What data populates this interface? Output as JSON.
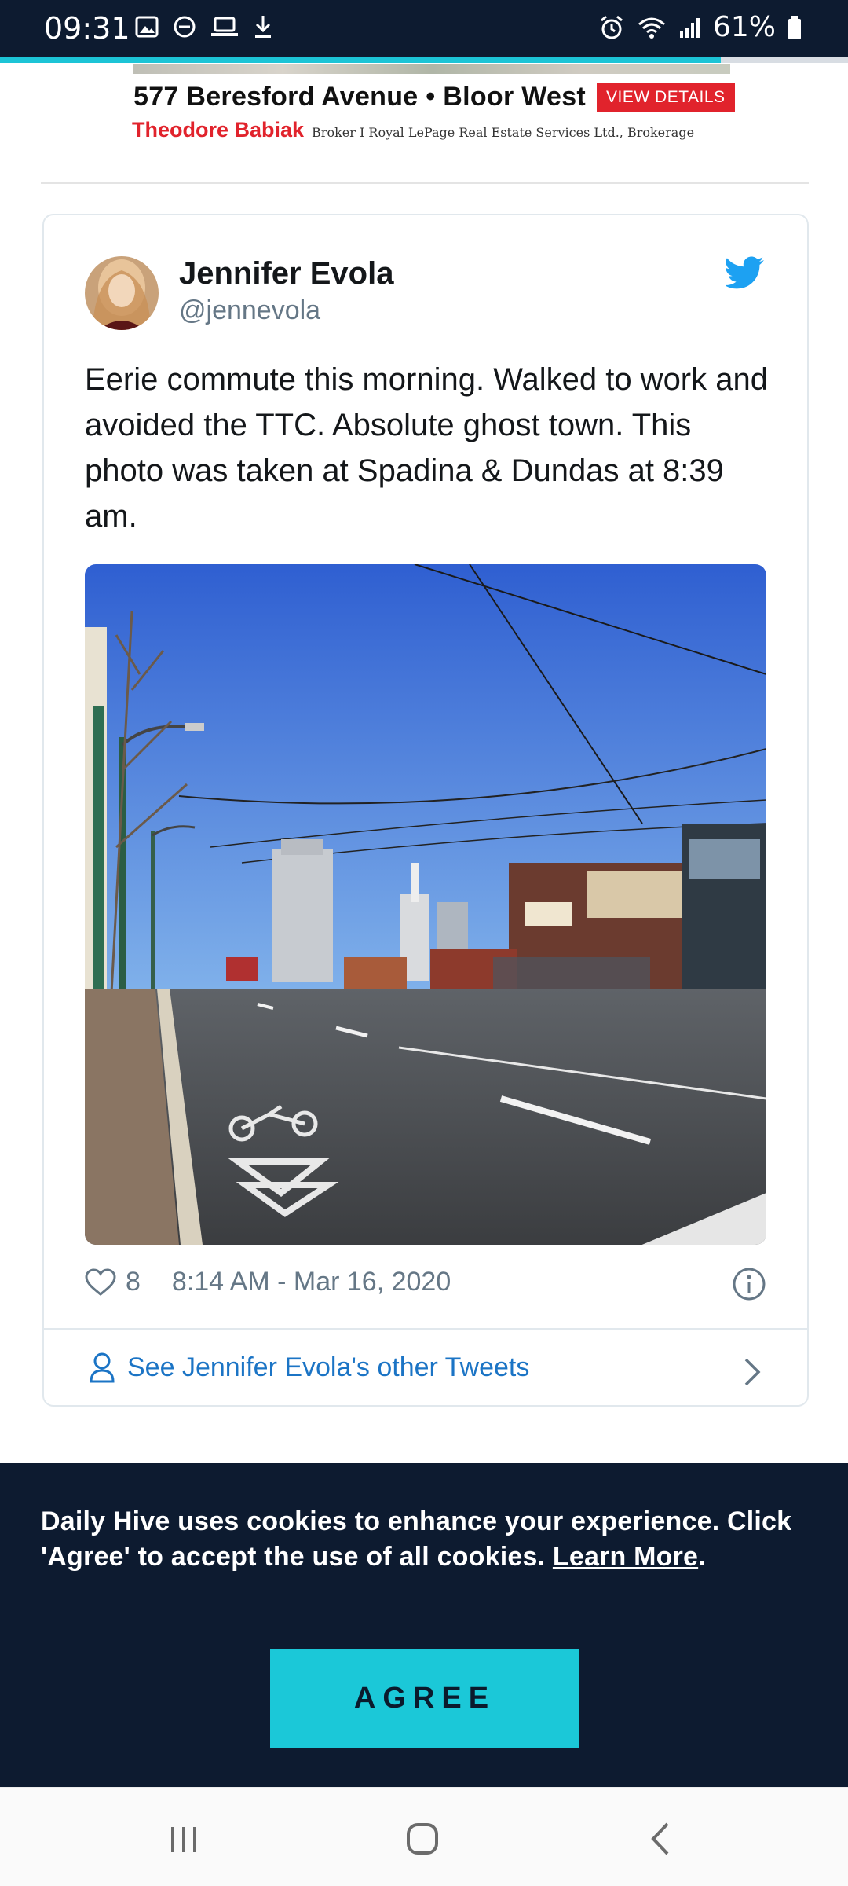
{
  "status_bar": {
    "time": "09:31",
    "battery": "61%",
    "icons_left": [
      "image-icon",
      "dnd-icon",
      "laptop-icon",
      "download-icon"
    ],
    "icons_right": [
      "alarm-icon",
      "wifi-icon",
      "signal-icon",
      "battery-icon"
    ]
  },
  "page_progress": 0.85,
  "ad": {
    "address": "577 Beresford Avenue • Bloor West",
    "view_details": "VIEW DETAILS",
    "agent": "Theodore Babiak",
    "brokerage": "Broker I Royal LePage Real Estate Services Ltd., Brokerage"
  },
  "tweet": {
    "author_name": "Jennifer Evola",
    "author_handle": "@jennevola",
    "text": "Eerie commute this morning. Walked to work and avoided the TTC. Absolute ghost town. This photo was taken at Spadina & Dundas at 8:39 am.",
    "like_count": "8",
    "timestamp": "8:14 AM - Mar 16, 2020",
    "other_tweets_label": "See Jennifer Evola's other Tweets"
  },
  "cookie_banner": {
    "text": "Daily Hive uses cookies to enhance your experience. Click 'Agree' to accept the use of all cookies. ",
    "link_text": "Learn More",
    "after_link": ".",
    "agree_label": "AGREE"
  },
  "colors": {
    "dark_navy": "#0d1b30",
    "accent_teal": "#1bc8d8",
    "twitter_blue": "#1da1f2",
    "link_blue": "#1b74c5",
    "ad_red": "#e1232c"
  }
}
